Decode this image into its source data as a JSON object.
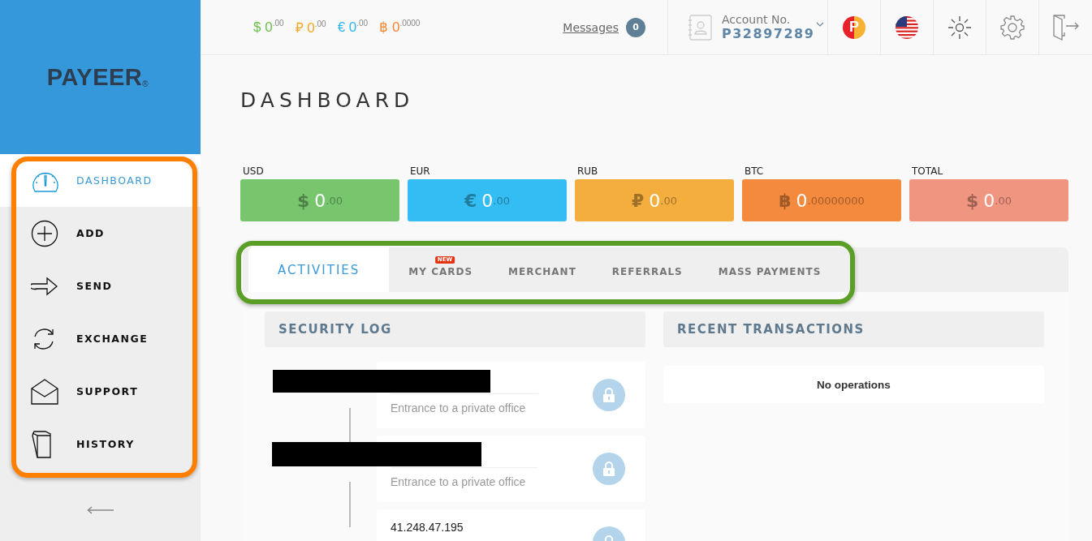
{
  "logo": {
    "text": "PAYEER",
    "mark": "®"
  },
  "sidebar": {
    "highlighted": true,
    "items": [
      {
        "label": "DASHBOARD",
        "selected": true
      },
      {
        "label": "ADD",
        "selected": false
      },
      {
        "label": "SEND",
        "selected": false
      },
      {
        "label": "EXCHANGE",
        "selected": false
      },
      {
        "label": "SUPPORT",
        "selected": false
      },
      {
        "label": "HISTORY",
        "selected": false
      }
    ]
  },
  "top_bar": {
    "balances": [
      {
        "symbol": "$",
        "amount": "0",
        "decimals": ".00",
        "color": "#6cc04a"
      },
      {
        "symbol": "₽",
        "amount": "0",
        "decimals": ".00",
        "color": "#f5a623"
      },
      {
        "symbol": "€",
        "amount": "0",
        "decimals": ".00",
        "color": "#29b6f6"
      },
      {
        "symbol": "฿",
        "amount": "0",
        "decimals": ".0000",
        "color": "#f58634"
      }
    ],
    "messages": {
      "label": "Messages",
      "count": "0"
    },
    "account": {
      "label": "Account No.",
      "number": "P32897289"
    },
    "brand_badge": "P"
  },
  "page_title": "DASHBOARD",
  "wallets": [
    {
      "code": "USD",
      "symbol": "$",
      "amount": "0",
      "decimals": ".00",
      "color": "#77c66e"
    },
    {
      "code": "EUR",
      "symbol": "€",
      "amount": "0",
      "decimals": ".00",
      "color": "#33bdf2"
    },
    {
      "code": "RUB",
      "symbol": "₽",
      "amount": "0",
      "decimals": ".00",
      "color": "#f4ae3e"
    },
    {
      "code": "BTC",
      "symbol": "฿",
      "amount": "0",
      "decimals": ".00000000",
      "color": "#f48a3e"
    },
    {
      "code": "TOTAL",
      "symbol": "$",
      "amount": "0",
      "decimals": ".00",
      "color": "#f09580"
    }
  ],
  "tab_bar": {
    "highlighted": true,
    "tabs": [
      {
        "label": "ACTIVITIES",
        "selected": true
      },
      {
        "label": "MY CARDS",
        "selected": false,
        "badge": "NEW"
      },
      {
        "label": "MERCHANT",
        "selected": false
      },
      {
        "label": "REFERRALS",
        "selected": false
      },
      {
        "label": "MASS PAYMENTS",
        "selected": false
      }
    ]
  },
  "security_log": {
    "title": "SECURITY LOG",
    "entries": [
      {
        "kind": "redacted",
        "note": "Entrance to a private office"
      },
      {
        "kind": "redacted",
        "note": "Entrance to a private office"
      },
      {
        "kind": "ip",
        "ip": "41.248.47.195"
      }
    ]
  },
  "recent_transactions": {
    "title": "RECENT TRANSACTIONS",
    "empty": "No operations"
  }
}
